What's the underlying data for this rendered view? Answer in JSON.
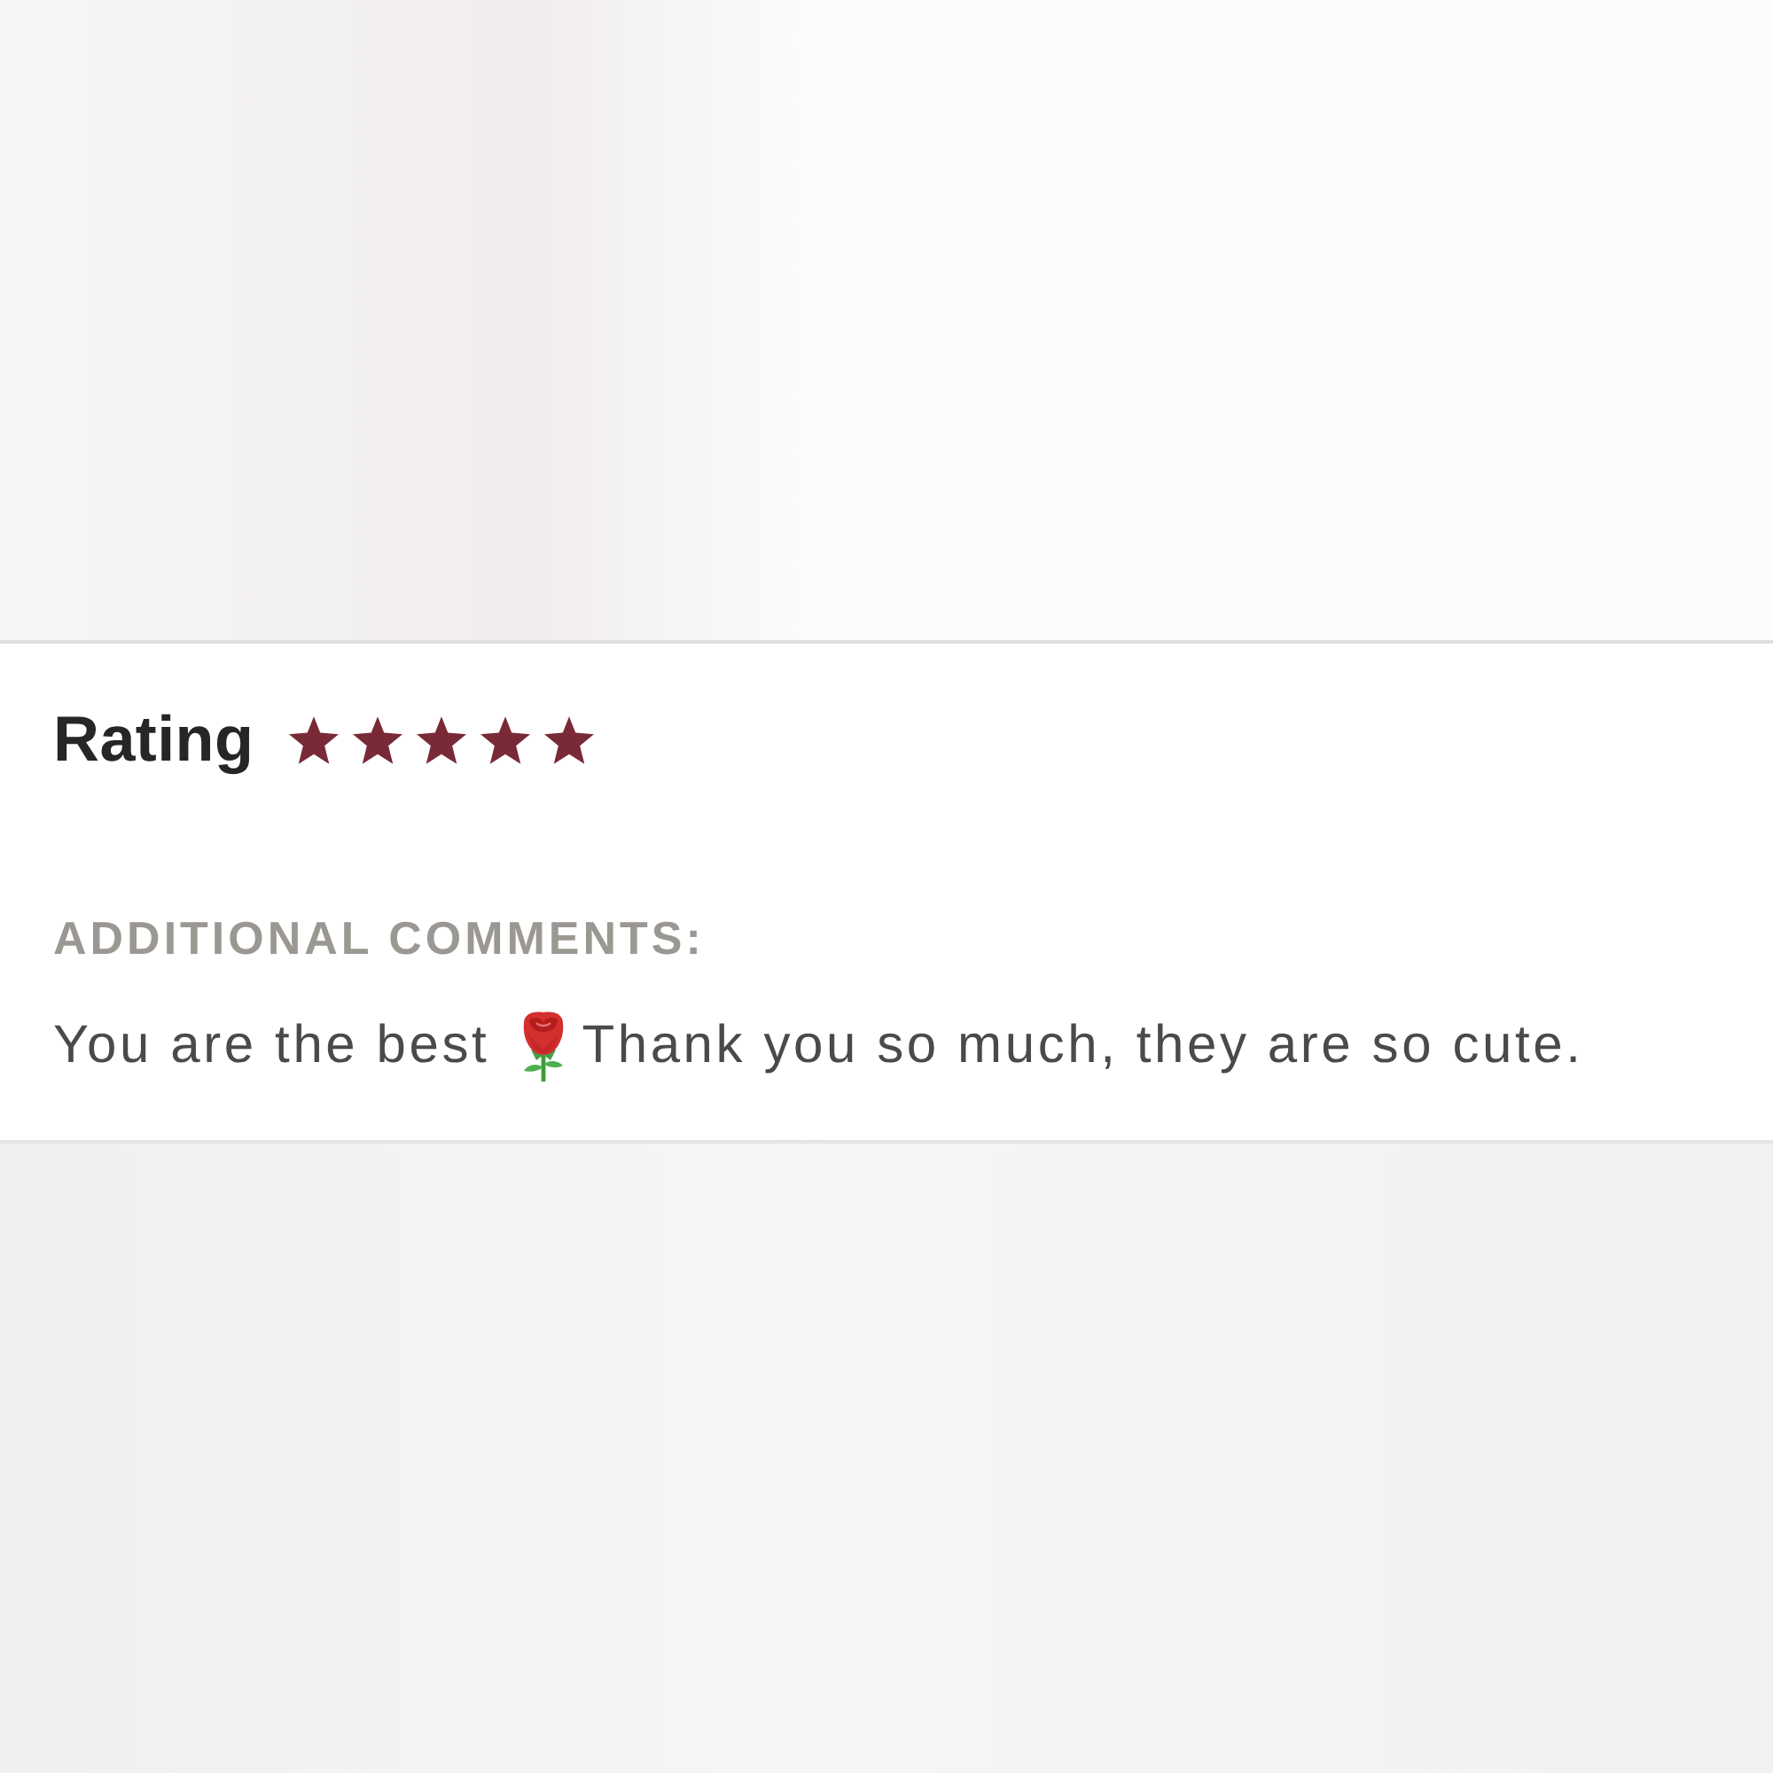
{
  "review": {
    "rating": {
      "label": "Rating",
      "stars": 5
    },
    "comments": {
      "label": "ADDITIONAL COMMENTS:",
      "parts": [
        {
          "kind": "text",
          "text": "You are the best"
        },
        {
          "kind": "emoji"
        },
        {
          "kind": "text",
          "text": "Thank you so much, they are so cute."
        }
      ]
    }
  }
}
